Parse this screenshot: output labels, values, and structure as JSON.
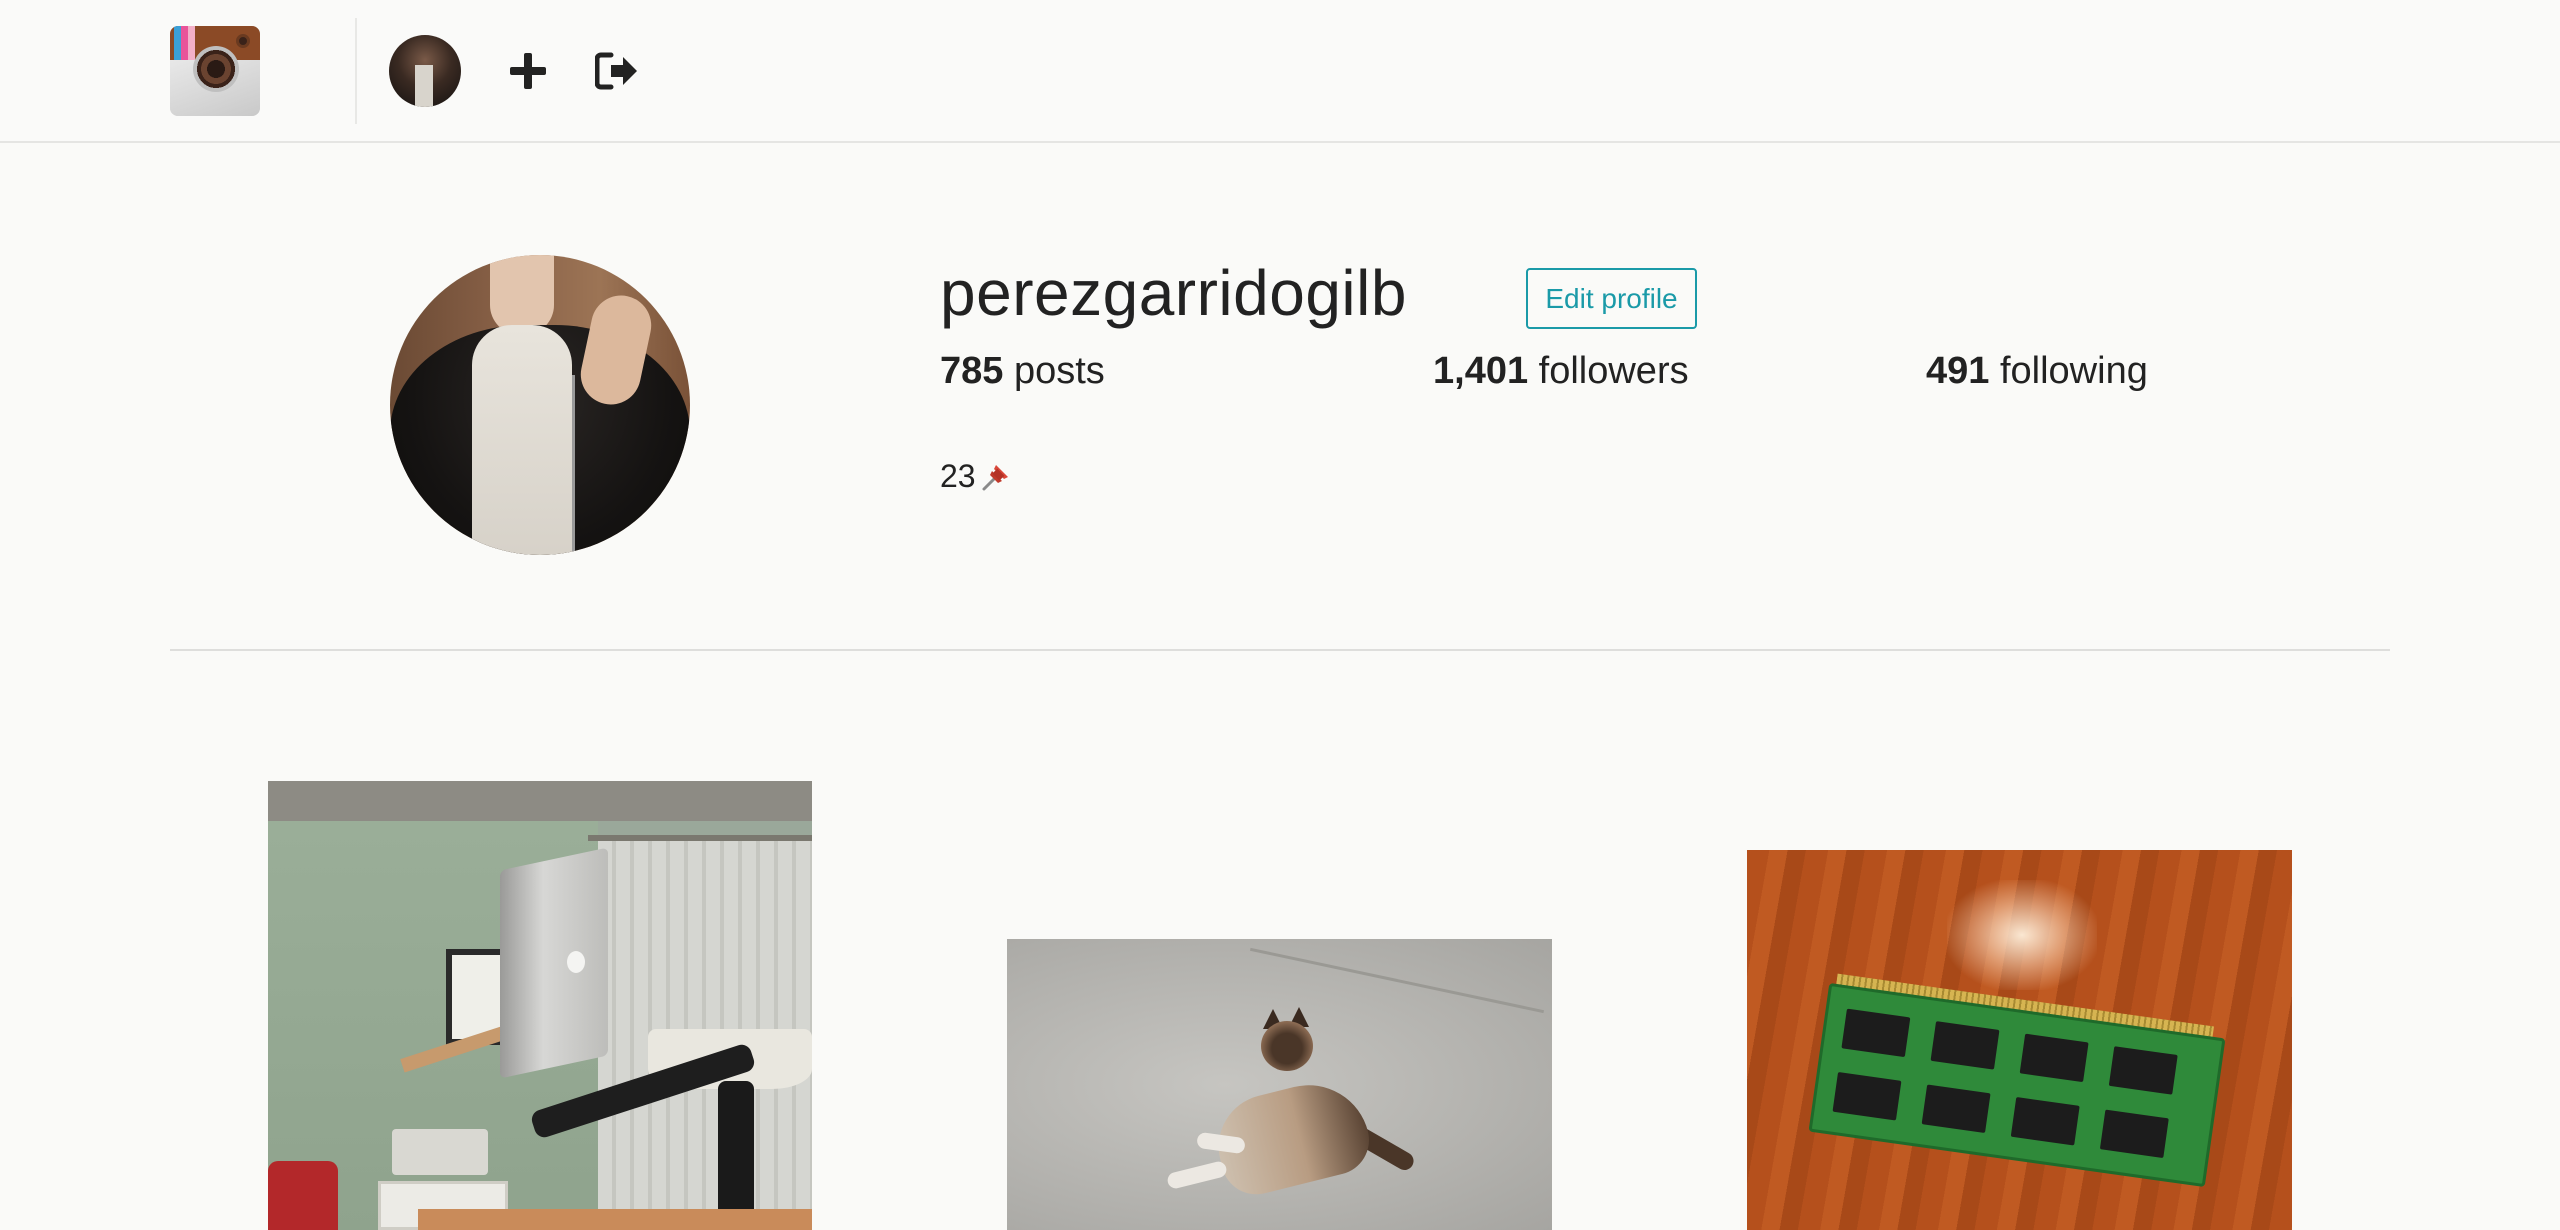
{
  "topbar": {
    "logo_icon": "camera-app-logo-icon",
    "avatar_icon": "user-avatar-icon",
    "new_post_icon": "plus-icon",
    "logout_icon": "logout-icon"
  },
  "profile": {
    "username": "perezgarridogilb",
    "edit_label": "Edit profile",
    "stats": {
      "posts_count": "785",
      "posts_label": "posts",
      "followers_count": "1,401",
      "followers_label": "followers",
      "following_count": "491",
      "following_label": "following"
    },
    "bio_text": "23",
    "bio_icon": "pushpin-icon"
  },
  "posts": [
    {
      "subject": "laptop-stand-room"
    },
    {
      "subject": "cat-on-concrete"
    },
    {
      "subject": "ram-module-on-wood"
    }
  ],
  "colors": {
    "accent": "#1a9aa8",
    "background": "#fafaf8",
    "text": "#222222"
  }
}
